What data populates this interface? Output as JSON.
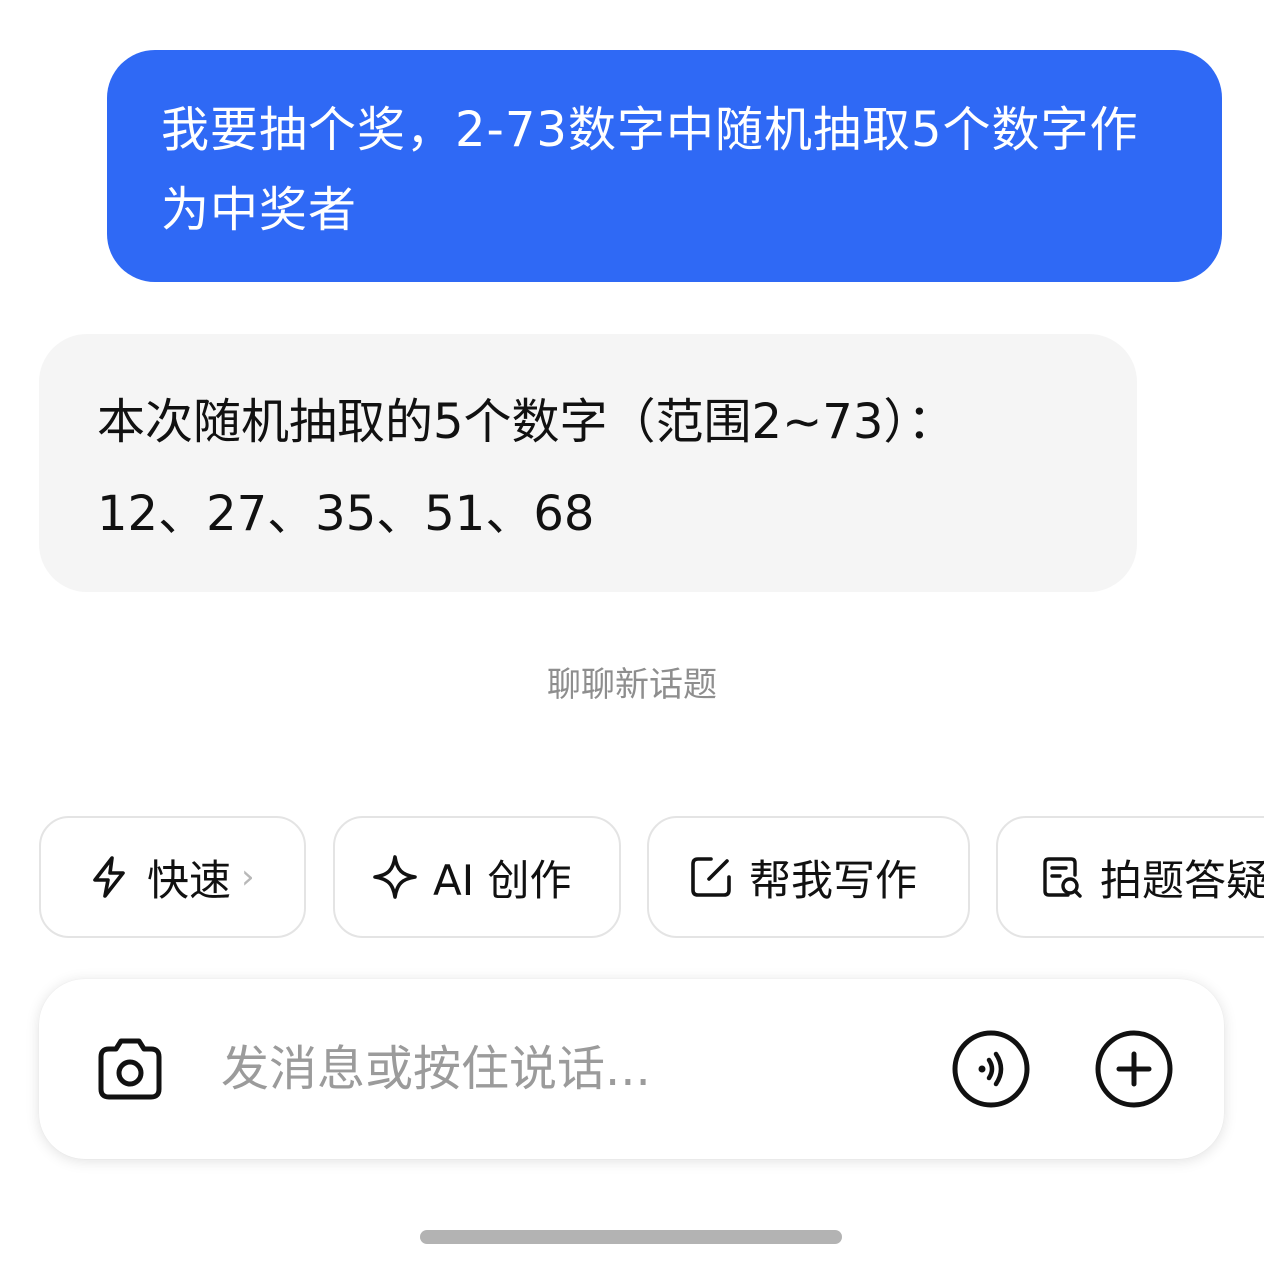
{
  "conversation": {
    "user_message": "我要抽个奖，2-73数字中随机抽取5个数字作为中奖者",
    "assistant_reply": {
      "line1": "本次随机抽取的5个数字（范围2~73）：",
      "line2": "12、27、35、51、68"
    },
    "new_topic": "聊聊新话题"
  },
  "quick_actions": [
    {
      "label": "快速",
      "icon": "lightning-icon",
      "has_chevron": true
    },
    {
      "label": "AI 创作",
      "icon": "sparkle-icon"
    },
    {
      "label": "帮我写作",
      "icon": "edit-icon"
    },
    {
      "label": "拍题答疑",
      "icon": "document-search-icon"
    }
  ],
  "input": {
    "placeholder": "发消息或按住说话...",
    "left_icon": "camera-icon",
    "right_icons": [
      "voice-icon",
      "plus-icon"
    ]
  },
  "colors": {
    "user_bubble": "#2f69f5",
    "assistant_bubble": "#f5f5f5",
    "muted_text": "#8e8e8e"
  }
}
